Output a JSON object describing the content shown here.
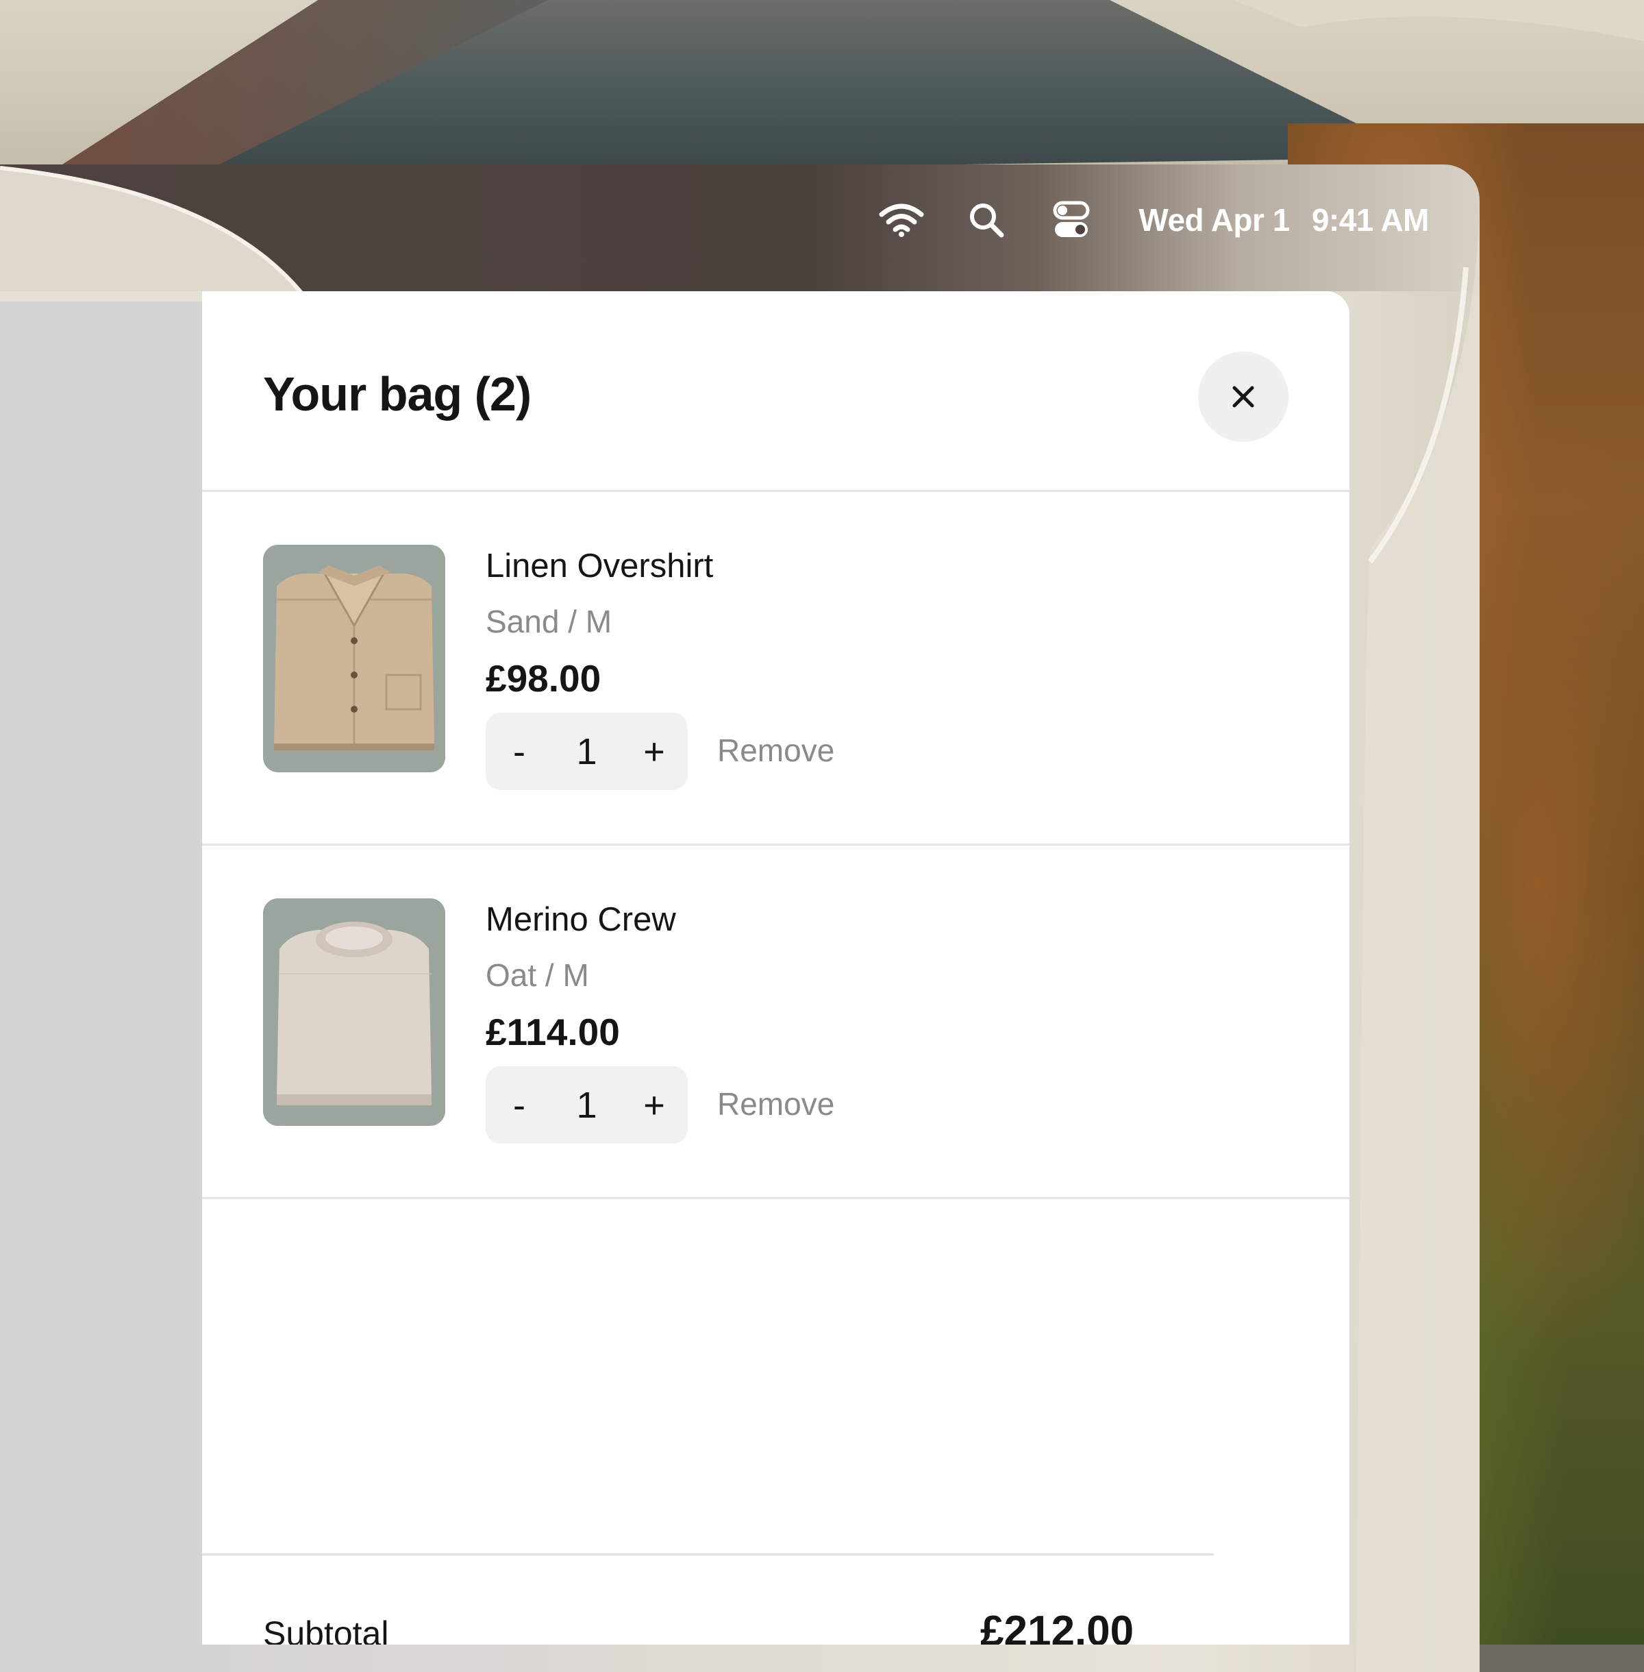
{
  "menubar": {
    "icons": [
      "wifi-icon",
      "search-icon",
      "control-center-icon"
    ],
    "date": "Wed Apr 1",
    "time": "9:41 AM"
  },
  "bag": {
    "title": "Your bag (2)",
    "close_icon": "close-icon",
    "items": [
      {
        "name": "Linen Overshirt",
        "variant": "Sand / M",
        "price": "£98.00",
        "quantity": "1",
        "decrement": "-",
        "increment": "+",
        "remove": "Remove",
        "thumbnail": "folded-shirt-image"
      },
      {
        "name": "Merino Crew",
        "variant": "Oat / M",
        "price": "£114.00",
        "quantity": "1",
        "decrement": "-",
        "increment": "+",
        "remove": "Remove",
        "thumbnail": "folded-sweater-image"
      }
    ],
    "subtotal_label": "Subtotal",
    "subtotal_value": "£212.00"
  },
  "colors": {
    "text_primary": "#151515",
    "text_secondary": "#8a8a8a",
    "control_bg": "#f1f1f1",
    "divider": "#e7e7e7",
    "menubar_bg": "#4b413d"
  }
}
